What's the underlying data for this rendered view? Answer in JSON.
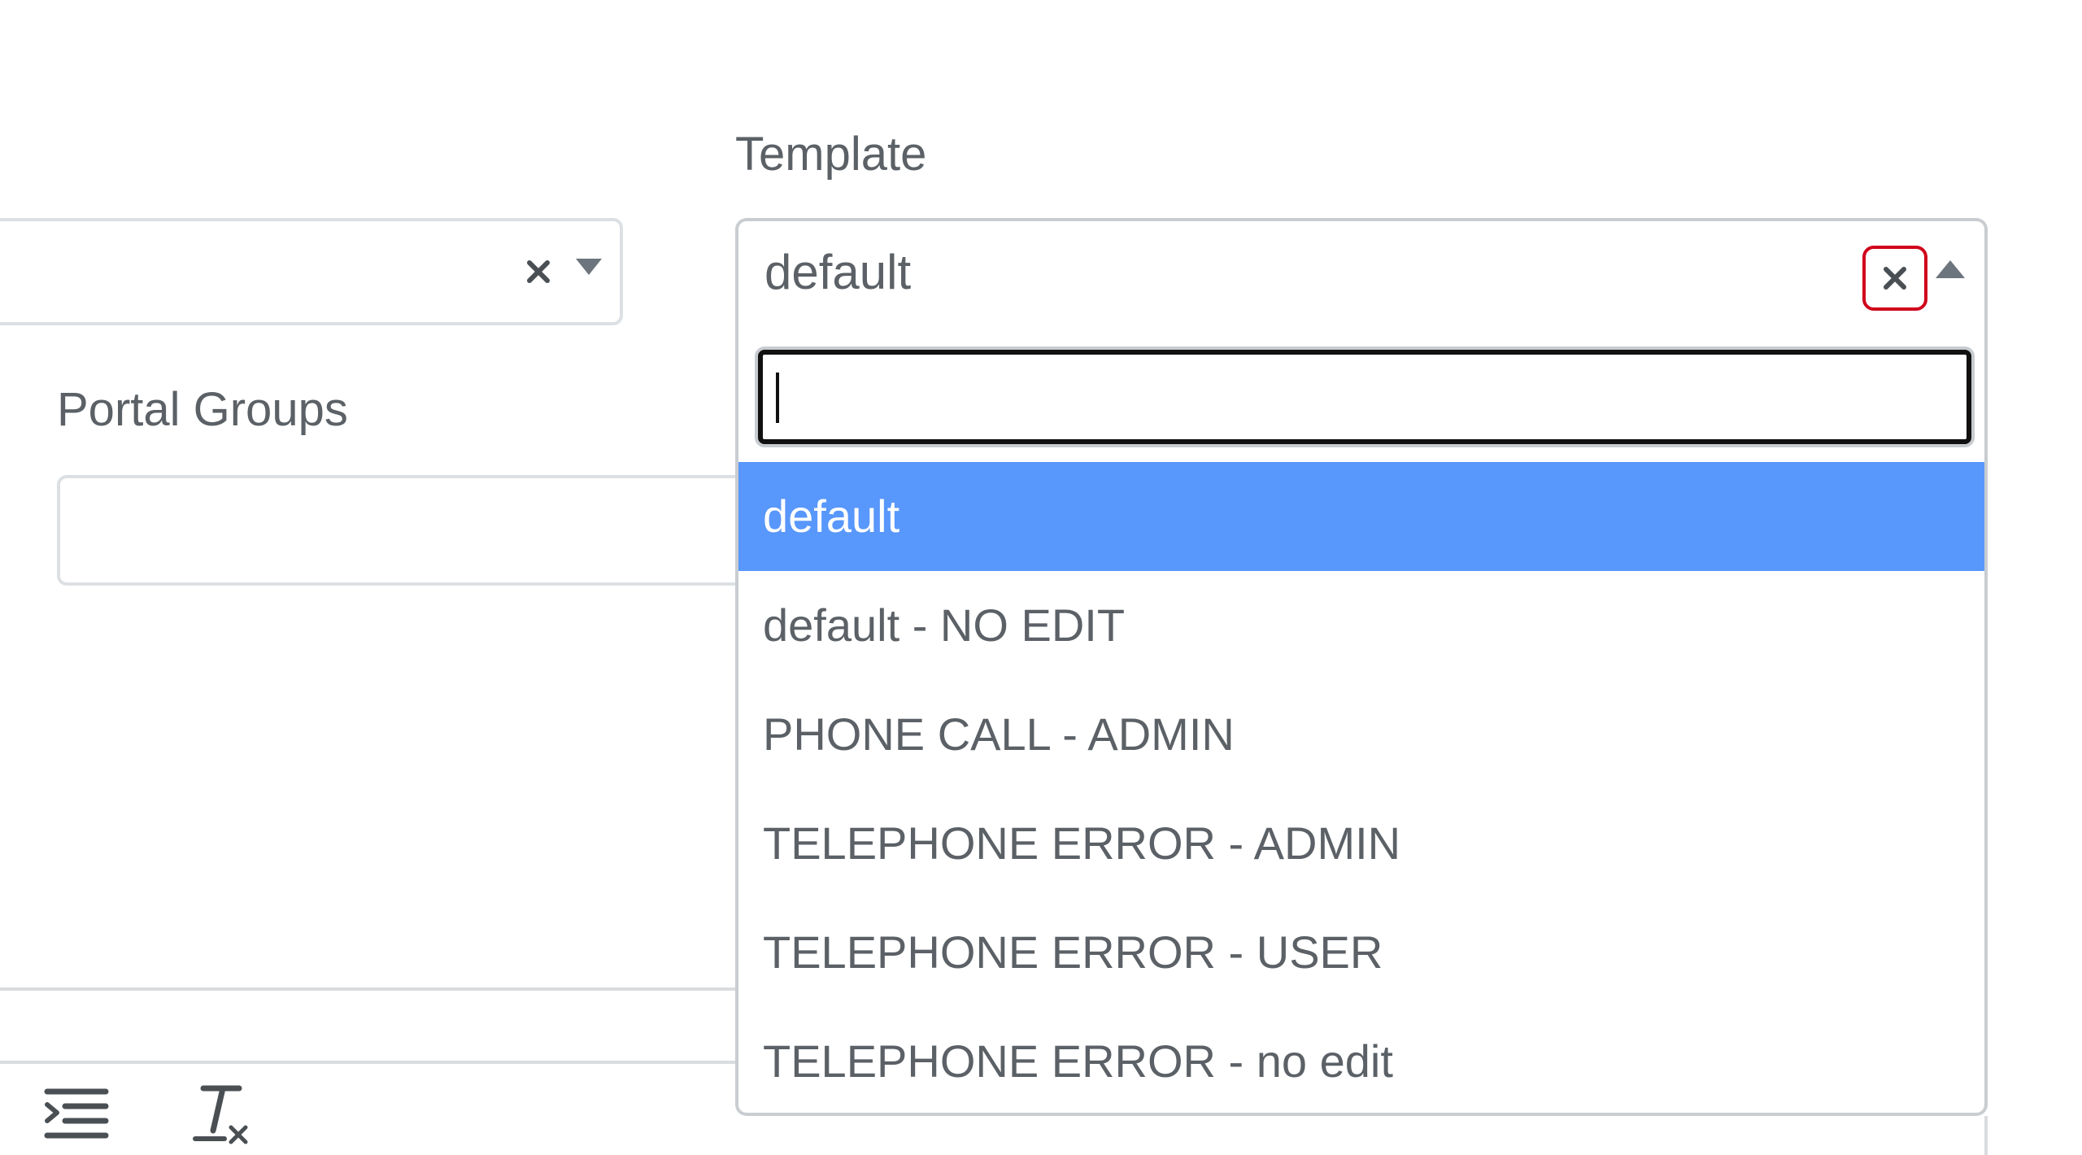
{
  "labels": {
    "template": "Template",
    "portal_groups": "Portal Groups"
  },
  "left_select": {
    "value": ""
  },
  "portal_groups": {
    "value": ""
  },
  "template_select": {
    "value": "default",
    "search_value": "",
    "options": [
      {
        "label": "default",
        "highlighted": true
      },
      {
        "label": "default - NO EDIT",
        "highlighted": false
      },
      {
        "label": "PHONE CALL - ADMIN",
        "highlighted": false
      },
      {
        "label": "TELEPHONE ERROR - ADMIN",
        "highlighted": false
      },
      {
        "label": "TELEPHONE ERROR - USER",
        "highlighted": false
      },
      {
        "label": "TELEPHONE ERROR - no edit",
        "highlighted": false
      }
    ]
  },
  "icons": {
    "left_clear": "close-icon",
    "left_arrow": "caret-down-icon",
    "template_clear": "close-icon",
    "template_arrow": "caret-up-icon",
    "indent": "indent-icon",
    "clear_format": "clear-format-icon"
  },
  "colors": {
    "highlight": "#5897fb",
    "clear_button_border": "#d0021b",
    "text": "#5b6166",
    "border": "#c9cdd1"
  }
}
